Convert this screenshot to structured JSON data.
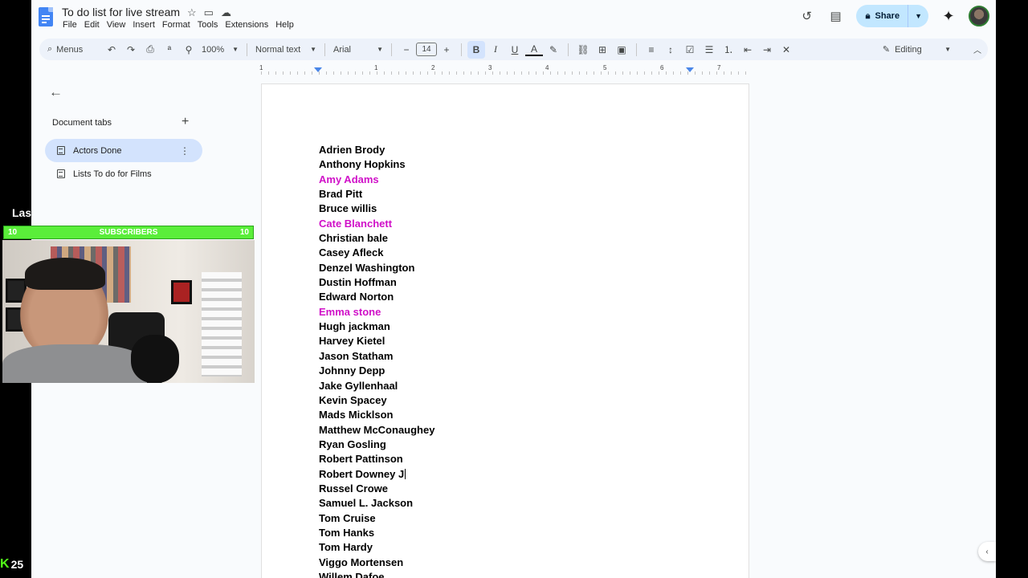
{
  "title_bar": {
    "doc_title": "To do list for live stream",
    "menu": [
      "File",
      "Edit",
      "View",
      "Insert",
      "Format",
      "Tools",
      "Extensions",
      "Help"
    ],
    "share_label": "Share"
  },
  "toolbar": {
    "search_label": "Menus",
    "zoom": "100%",
    "style": "Normal text",
    "font": "Arial",
    "font_size": "14",
    "mode": "Editing"
  },
  "ruler": {
    "numbers": [
      "1",
      "1",
      "2",
      "3",
      "4",
      "5",
      "6",
      "7"
    ]
  },
  "sidebar": {
    "header": "Document tabs",
    "tabs": [
      {
        "label": "Actors Done",
        "active": true
      },
      {
        "label": "Lists To do for Films",
        "active": false
      }
    ]
  },
  "document": {
    "lines": [
      {
        "text": "Adrien Brody",
        "pink": false
      },
      {
        "text": "Anthony Hopkins",
        "pink": false
      },
      {
        "text": "Amy Adams",
        "pink": true
      },
      {
        "text": "Brad Pitt",
        "pink": false
      },
      {
        "text": "Bruce willis",
        "pink": false
      },
      {
        "text": "Cate Blanchett",
        "pink": true
      },
      {
        "text": "Christian bale",
        "pink": false
      },
      {
        "text": "Casey Afleck",
        "pink": false
      },
      {
        "text": "Denzel Washington",
        "pink": false
      },
      {
        "text": "Dustin Hoffman",
        "pink": false
      },
      {
        "text": "Edward Norton",
        "pink": false
      },
      {
        "text": "Emma stone",
        "pink": true
      },
      {
        "text": "Hugh jackman",
        "pink": false
      },
      {
        "text": "Harvey Kietel",
        "pink": false
      },
      {
        "text": "Jason Statham",
        "pink": false
      },
      {
        "text": "Johnny Depp",
        "pink": false
      },
      {
        "text": "Jake Gyllenhaal",
        "pink": false
      },
      {
        "text": "Kevin Spacey",
        "pink": false
      },
      {
        "text": "Mads Micklson",
        "pink": false
      },
      {
        "text": "Matthew McConaughey",
        "pink": false
      },
      {
        "text": "Ryan Gosling",
        "pink": false
      },
      {
        "text": "Robert Pattinson",
        "pink": false
      },
      {
        "text": "Robert Downey J",
        "pink": false,
        "cursor": true
      },
      {
        "text": "Russel Crowe",
        "pink": false
      },
      {
        "text": "Samuel L. Jackson",
        "pink": false
      },
      {
        "text": "Tom Cruise",
        "pink": false
      },
      {
        "text": "Tom Hanks",
        "pink": false
      },
      {
        "text": "Tom Hardy",
        "pink": false
      },
      {
        "text": "Viggo Mortensen",
        "pink": false
      },
      {
        "text": "Willem Dafoe",
        "pink": false
      }
    ]
  },
  "overlay": {
    "label_visible": "Las",
    "subscribers_left": "10",
    "subscribers_label": "SUBSCRIBERS",
    "subscribers_right": "10",
    "viewer_count": "25"
  },
  "colors": {
    "pink_text": "#d010c8",
    "share_bg": "#c2e7ff",
    "active_tab": "#d3e3fd",
    "subscriber_bar": "#5aee3a",
    "kick_green": "#53fc18"
  }
}
